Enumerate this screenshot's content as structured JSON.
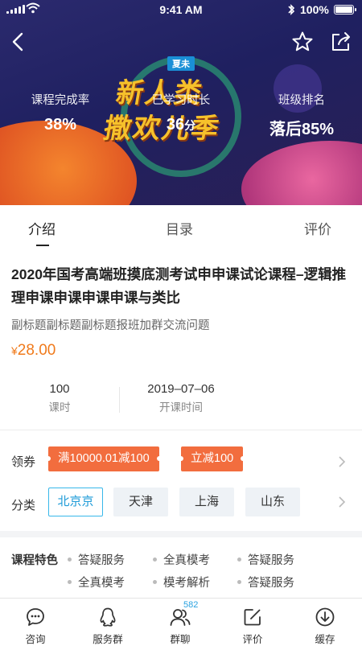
{
  "status_bar": {
    "time": "9:41 AM",
    "battery": "100%"
  },
  "nav": {
    "back_icon": "chevron-left-icon",
    "fav_icon": "star-outline-icon",
    "share_icon": "share-icon"
  },
  "hero": {
    "banner_tag": "夏未",
    "banner_line1": "新人类",
    "banner_line2": "撒欢儿季",
    "stats": [
      {
        "label": "课程完成率",
        "value": "38%",
        "unit": ""
      },
      {
        "label": "已学习时长",
        "value": "36",
        "unit": "分"
      },
      {
        "label": "班级排名",
        "value": "落后85%",
        "unit": ""
      }
    ]
  },
  "tabs": [
    {
      "label": "介绍",
      "active": true
    },
    {
      "label": "目录",
      "active": false
    },
    {
      "label": "评价",
      "active": false
    }
  ],
  "course": {
    "title": "2020年国考高端班摸底测考试申申课试论课程–逻辑推理申课申课申课申课与类比",
    "subtitle": "副标题副标题副标题报班加群交流问题",
    "price_symbol": "¥",
    "price": "28.00",
    "lessons_value": "100",
    "lessons_label": "课时",
    "start_value": "2019–07–06",
    "start_label": "开课时间"
  },
  "coupons": {
    "label": "领券",
    "items": [
      "满10000.01减100",
      "立减100"
    ]
  },
  "categories": {
    "label": "分类",
    "items": [
      "北京京",
      "天津",
      "上海",
      "山东"
    ],
    "selected": "北京京"
  },
  "features": {
    "label": "课程特色",
    "items": [
      "答疑服务",
      "全真模考",
      "答疑服务",
      "全真模考",
      "模考解析",
      "答疑服务"
    ]
  },
  "bottom_bar": {
    "items": [
      {
        "label": "咨询",
        "icon": "chat-bubble-icon"
      },
      {
        "label": "服务群",
        "icon": "qq-penguin-icon"
      },
      {
        "label": "群聊",
        "icon": "group-chat-icon"
      },
      {
        "label": "评价",
        "icon": "edit-review-icon"
      },
      {
        "label": "缓存",
        "icon": "download-icon"
      }
    ],
    "group_chat_badge": "582"
  },
  "colors": {
    "accent_orange": "#f07a1b",
    "coupon_bg": "#f26d3e",
    "selected_blue": "#1e9bd8",
    "hero_bg": "#1f2060"
  }
}
